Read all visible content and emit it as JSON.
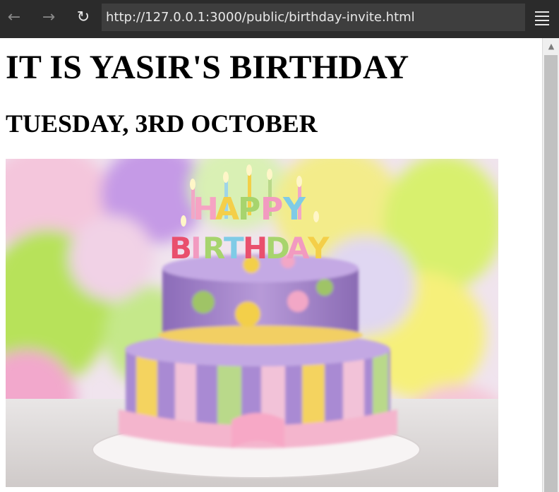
{
  "browser": {
    "url": "http://127.0.0.1:3000/public/birthday-invite.html",
    "icons": {
      "back": "arrow-left-icon",
      "forward": "arrow-right-icon",
      "reload": "reload-icon",
      "menu": "hamburger-menu-icon",
      "scroll_up": "chevron-up-icon"
    }
  },
  "page": {
    "heading": "IT IS YASIR'S BIRTHDAY",
    "subheading": "TUESDAY, 3RD OCTOBER",
    "image": {
      "subject": "birthday cake with candles and balloons",
      "cake_topper_text": "HAPPY BIRTHDAY"
    }
  },
  "colors": {
    "toolbar_bg": "#2b2b2b",
    "url_bar_bg": "#3e3e3e",
    "scrollbar_thumb": "#c1c1c1"
  }
}
